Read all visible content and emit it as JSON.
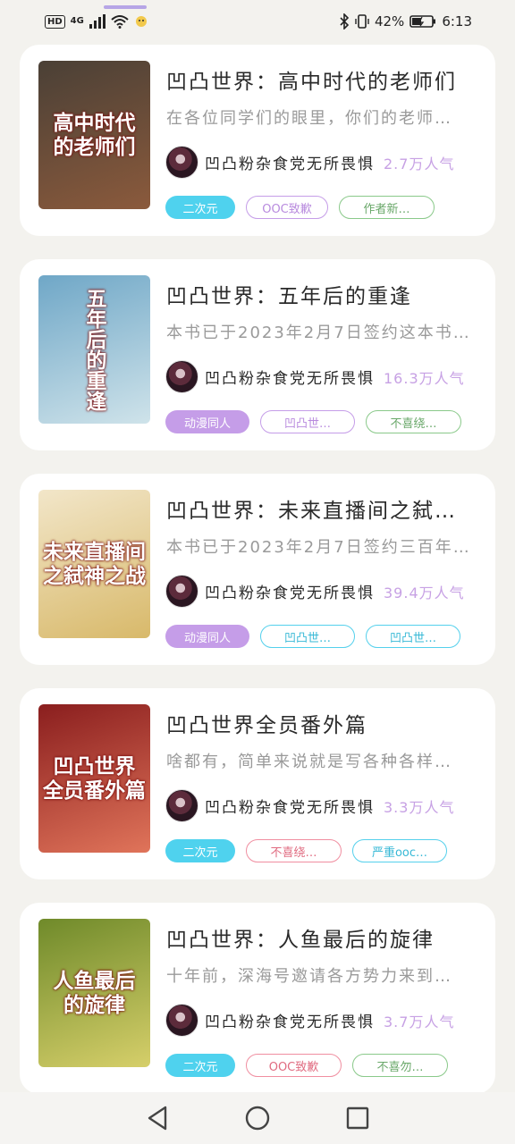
{
  "status": {
    "hd": "HD",
    "network": "4G",
    "battery": "42%",
    "time": "6:13"
  },
  "books": [
    {
      "title": "凹凸世界：高中时代的老师们",
      "desc": "在各位同学们的眼里，你们的老师…",
      "cover_text": "高中时代\n的老师们",
      "cover_colors": [
        "#4a4036",
        "#8b5a3c"
      ],
      "author": "凹凸粉杂食党无所畏惧",
      "popularity": "2.7万人气",
      "tags": [
        {
          "label": "二次元",
          "style": "fill-blue"
        },
        {
          "label": "OOC致歉",
          "style": "out-purple"
        },
        {
          "label": "作者新…",
          "style": "out-green"
        }
      ]
    },
    {
      "title": "凹凸世界：五年后的重逢",
      "desc": "本书已于2023年2月7日签约这本书…",
      "cover_text": "五年后的重逢",
      "cover_colors": [
        "#6fa7c7",
        "#cfe3ea"
      ],
      "author": "凹凸粉杂食党无所畏惧",
      "popularity": "16.3万人气",
      "tags": [
        {
          "label": "动漫同人",
          "style": "fill-purple"
        },
        {
          "label": "凹凸世…",
          "style": "out-purple wide"
        },
        {
          "label": "不喜绕…",
          "style": "out-green"
        }
      ]
    },
    {
      "title": "凹凸世界：未来直播间之弑…",
      "desc": "本书已于2023年2月7日签约三百年…",
      "cover_text": "未来直播间\n之弑神之战",
      "cover_colors": [
        "#f2e6c9",
        "#d8b96a"
      ],
      "author": "凹凸粉杂食党无所畏惧",
      "popularity": "39.4万人气",
      "tags": [
        {
          "label": "动漫同人",
          "style": "fill-purple"
        },
        {
          "label": "凹凸世…",
          "style": "out-cyan"
        },
        {
          "label": "凹凸世…",
          "style": "out-cyan"
        }
      ]
    },
    {
      "title": "凹凸世界全员番外篇",
      "desc": "啥都有，简单来说就是写各种各样…",
      "cover_text": "凹凸世界\n全员番外篇",
      "cover_colors": [
        "#8a1e1e",
        "#e0745a"
      ],
      "author": "凹凸粉杂食党无所畏惧",
      "popularity": "3.3万人气",
      "tags": [
        {
          "label": "二次元",
          "style": "fill-blue"
        },
        {
          "label": "不喜绕…",
          "style": "out-pink"
        },
        {
          "label": "严重ooc…",
          "style": "out-cyan"
        }
      ]
    },
    {
      "title": "凹凸世界：人鱼最后的旋律",
      "desc": "十年前，深海号邀请各方势力来到…",
      "cover_text": "人鱼最后\n的旋律",
      "cover_colors": [
        "#6f8a2a",
        "#d6cf6a"
      ],
      "author": "凹凸粉杂食党无所畏惧",
      "popularity": "3.7万人气",
      "tags": [
        {
          "label": "二次元",
          "style": "fill-blue"
        },
        {
          "label": "OOC致歉",
          "style": "out-pink"
        },
        {
          "label": "不喜勿…",
          "style": "out-green"
        }
      ]
    }
  ],
  "icons": {
    "back": "back-triangle-icon",
    "home": "home-circle-icon",
    "recents": "recents-square-icon"
  }
}
